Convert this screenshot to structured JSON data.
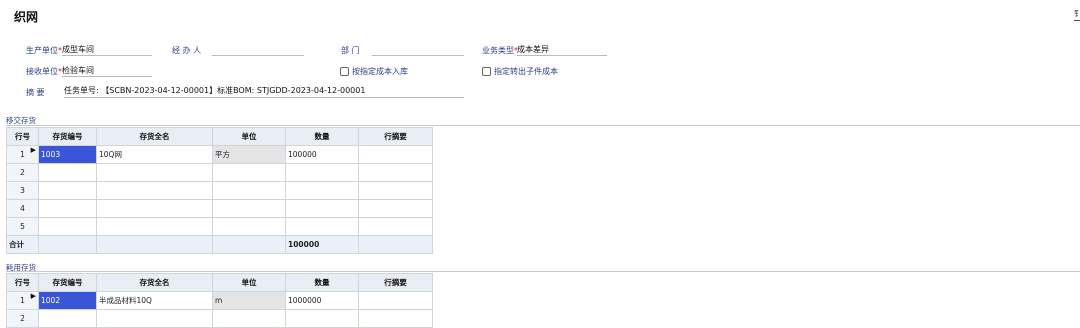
{
  "page": {
    "title": "织网",
    "corner_glyph": "钅"
  },
  "form": {
    "prod_unit_label": "生产单位",
    "prod_unit_value": "成型车间",
    "handler_label": "经 办 人",
    "handler_value": "",
    "dept_label": "部    门",
    "dept_value": "",
    "biz_type_label": "业务类型",
    "biz_type_value": "成本差异",
    "recv_unit_label": "接收单位",
    "recv_unit_value": "检验车间",
    "opt_cost_in": "按指定成本入库",
    "opt_child_cost": "指定转出子件成本",
    "summary_label": "摘    要",
    "summary_value": "任务单号: 【SCBN-2023-04-12-00001】标准BOM: STJGDD-2023-04-12-00001"
  },
  "transfer": {
    "section": "移交存货",
    "headers": [
      "行号",
      "存货编号",
      "存货全名",
      "单位",
      "数量",
      "行摘要"
    ],
    "rows": [
      {
        "no": "1",
        "code": "1003",
        "name": "10Q网",
        "unit": "平方",
        "qty": "100000",
        "note": ""
      },
      {
        "no": "2",
        "code": "",
        "name": "",
        "unit": "",
        "qty": "",
        "note": ""
      },
      {
        "no": "3",
        "code": "",
        "name": "",
        "unit": "",
        "qty": "",
        "note": ""
      },
      {
        "no": "4",
        "code": "",
        "name": "",
        "unit": "",
        "qty": "",
        "note": ""
      },
      {
        "no": "5",
        "code": "",
        "name": "",
        "unit": "",
        "qty": "",
        "note": ""
      }
    ],
    "total_label": "合计",
    "total_qty": "100000"
  },
  "consume": {
    "section": "耗用存货",
    "headers": [
      "行号",
      "存货编号",
      "存货全名",
      "单位",
      "数量",
      "行摘要"
    ],
    "rows": [
      {
        "no": "1",
        "code": "1002",
        "name": "半成品材料10Q",
        "unit": "m",
        "qty": "1000000",
        "note": ""
      },
      {
        "no": "2",
        "code": "",
        "name": "",
        "unit": "",
        "qty": "",
        "note": ""
      }
    ]
  }
}
